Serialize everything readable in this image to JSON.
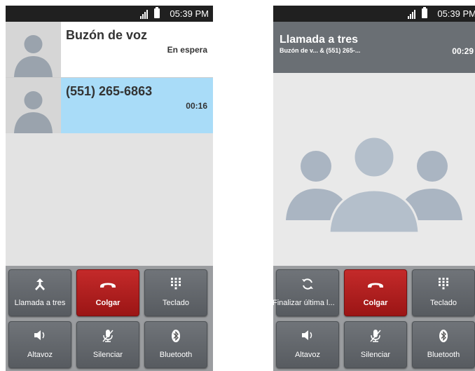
{
  "status_bar": {
    "time": "05:39 PM"
  },
  "left_screen": {
    "calls": [
      {
        "name": "Buzón de voz",
        "status": "En espera"
      },
      {
        "name": "(551) 265-6863",
        "status": "00:16"
      }
    ],
    "buttons": [
      {
        "label": "Llamada a tres",
        "icon": "merge-arrow-icon"
      },
      {
        "label": "Colgar",
        "icon": "hang-up-icon"
      },
      {
        "label": "Teclado",
        "icon": "dialpad-icon"
      },
      {
        "label": "Altavoz",
        "icon": "speaker-icon"
      },
      {
        "label": "Silenciar",
        "icon": "mute-mic-icon"
      },
      {
        "label": "Bluetooth",
        "icon": "bluetooth-icon"
      }
    ]
  },
  "right_screen": {
    "title": "Llamada a tres",
    "participants": "Buzón de v...  &  (551) 265-...",
    "timer": "00:29",
    "buttons": [
      {
        "label": "Finalizar última l...",
        "icon": "swap-icon"
      },
      {
        "label": "Colgar",
        "icon": "hang-up-icon"
      },
      {
        "label": "Teclado",
        "icon": "dialpad-icon"
      },
      {
        "label": "Altavoz",
        "icon": "speaker-icon"
      },
      {
        "label": "Silenciar",
        "icon": "mute-mic-icon"
      },
      {
        "label": "Bluetooth",
        "icon": "bluetooth-icon"
      }
    ]
  },
  "colors": {
    "hangup_red": "#b31f1f",
    "active_row": "#a9dcf8",
    "button_gray": "#63676c"
  }
}
